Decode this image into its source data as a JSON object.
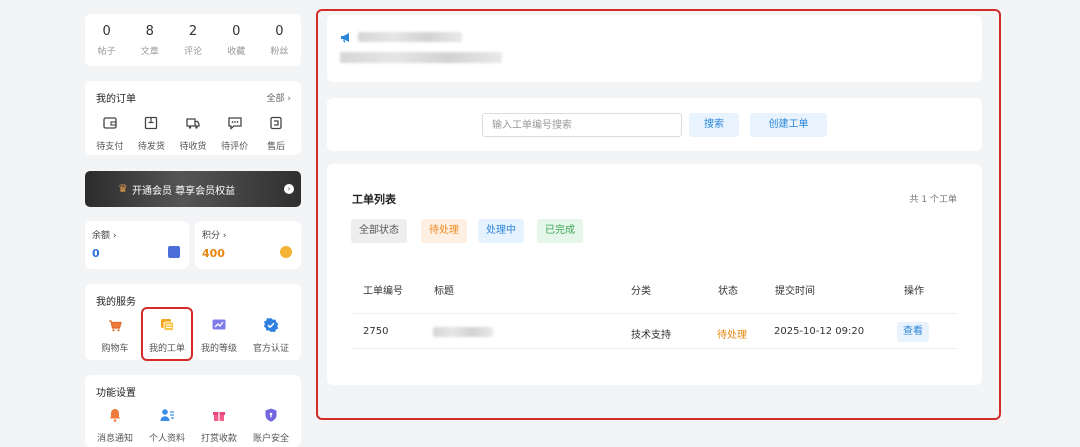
{
  "stats": [
    {
      "value": "0",
      "label": "帖子"
    },
    {
      "value": "8",
      "label": "文章"
    },
    {
      "value": "2",
      "label": "评论"
    },
    {
      "value": "0",
      "label": "收藏"
    },
    {
      "value": "0",
      "label": "粉丝"
    }
  ],
  "orders": {
    "title": "我的订单",
    "all_label": "全部 ›",
    "items": [
      {
        "label": "待支付",
        "icon": "wallet-icon"
      },
      {
        "label": "待发货",
        "icon": "package-icon"
      },
      {
        "label": "待收货",
        "icon": "truck-icon"
      },
      {
        "label": "待评价",
        "icon": "comment-icon"
      },
      {
        "label": "售后",
        "icon": "return-icon"
      }
    ]
  },
  "vip": {
    "label": "开通会员 尊享会员权益",
    "icon": "crown-icon",
    "accent": "#e9a24a"
  },
  "balance": {
    "label": "余额 ›",
    "value": "0",
    "color": "#2a6fdb"
  },
  "points": {
    "label": "积分 ›",
    "value": "400",
    "color": "#e8870f"
  },
  "services": {
    "title": "我的服务",
    "items": [
      {
        "label": "购物车",
        "icon": "cart-icon"
      },
      {
        "label": "我的工单",
        "icon": "workorder-icon"
      },
      {
        "label": "我的等级",
        "icon": "level-chart-icon"
      },
      {
        "label": "官方认证",
        "icon": "verified-icon"
      }
    ]
  },
  "features": {
    "title": "功能设置",
    "items": [
      {
        "label": "消息通知",
        "icon": "bell-icon"
      },
      {
        "label": "个人资料",
        "icon": "profile-icon"
      },
      {
        "label": "打赏收款",
        "icon": "gift-icon"
      },
      {
        "label": "账户安全",
        "icon": "shield-icon"
      }
    ]
  },
  "notice": {
    "icon": "megaphone-icon"
  },
  "search": {
    "placeholder": "输入工单编号搜索",
    "search_label": "搜索",
    "create_label": "创建工单"
  },
  "ticket_list": {
    "title": "工单列表",
    "count_label": "共 1 个工单",
    "filters": [
      {
        "label": "全部状态",
        "color": "#555555"
      },
      {
        "label": "待处理",
        "color": "#f08a24"
      },
      {
        "label": "处理中",
        "color": "#2a86d9"
      },
      {
        "label": "已完成",
        "color": "#3aa657"
      }
    ],
    "columns": [
      "工单编号",
      "标题",
      "分类",
      "状态",
      "提交时间",
      "操作"
    ],
    "rows": [
      {
        "id": "2750",
        "category": "技术支持",
        "status": "待处理",
        "status_color": "#e8870f",
        "time": "2025-10-12 09:20",
        "action": "查看"
      }
    ]
  },
  "highlight_color": "#d42a2a"
}
